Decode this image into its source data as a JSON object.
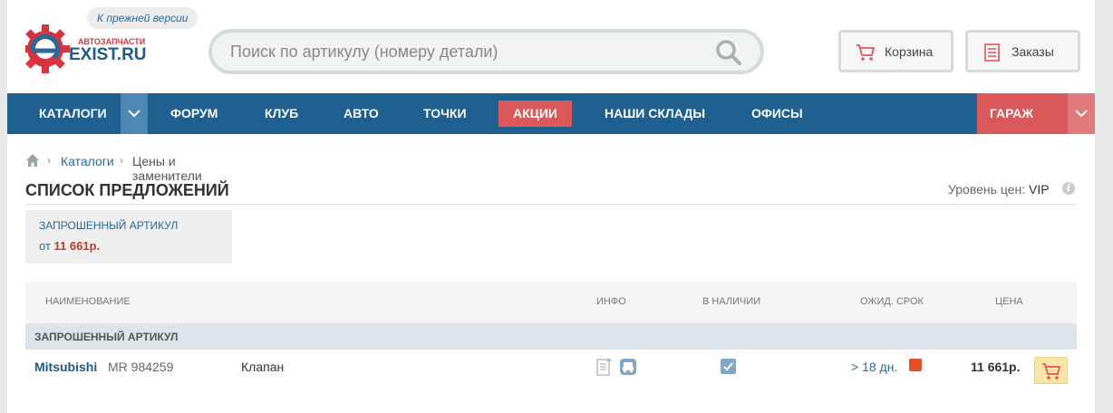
{
  "header": {
    "old_version_label": "К прежней версии",
    "logo_brand_top": "АВТОЗАПЧАСТИ",
    "logo_brand_main": "EXIST.RU",
    "search_placeholder": "Поиск по артикулу (номеру детали)",
    "search_value": "",
    "cart_label": "Корзина",
    "orders_label": "Заказы"
  },
  "nav": {
    "items": [
      {
        "label": "Каталоги"
      },
      {
        "label": "Форум"
      },
      {
        "label": "Клуб"
      },
      {
        "label": "Авто"
      },
      {
        "label": "Точки"
      },
      {
        "label": "Акции"
      },
      {
        "label": "Наши склады"
      },
      {
        "label": "Офисы"
      }
    ],
    "garage_label": "ГАРАЖ"
  },
  "breadcrumb": {
    "items": [
      "Каталоги",
      "Цены и заменители"
    ]
  },
  "page": {
    "title": "СПИСОК ПРЕДЛОЖЕНИЙ",
    "price_level_label": "Уровень цен:",
    "price_level_value": "VIP",
    "info_glyph": "i"
  },
  "requested": {
    "label": "Запрошенный артикул",
    "price_prefix": "от",
    "price_value": "11 661р."
  },
  "table": {
    "columns": [
      "Наименование",
      "Инфо",
      "В наличии",
      "Ожид. срок",
      "Цена"
    ],
    "group_label": "Запрошенный артикул",
    "rows": [
      {
        "brand": "Mitsubishi",
        "article": "MR 984259",
        "name": "Клапан",
        "delivery": "> 18 дн.",
        "price": "11 661р.",
        "in_stock": true
      }
    ]
  },
  "colors": {
    "nav_bg": "#1f6090",
    "accent_red": "#d9585a",
    "link_blue": "#2a6a9a",
    "status_orange": "#e4502b",
    "buy_yellow": "#f9e6a7"
  },
  "icons": {
    "search": "search-icon",
    "cart": "cart-icon",
    "orders": "list-icon",
    "home": "home-icon",
    "doc": "document-icon",
    "car": "car-icon",
    "check": "checkbox-checked-icon",
    "dropdown": "chevron-down-icon"
  }
}
